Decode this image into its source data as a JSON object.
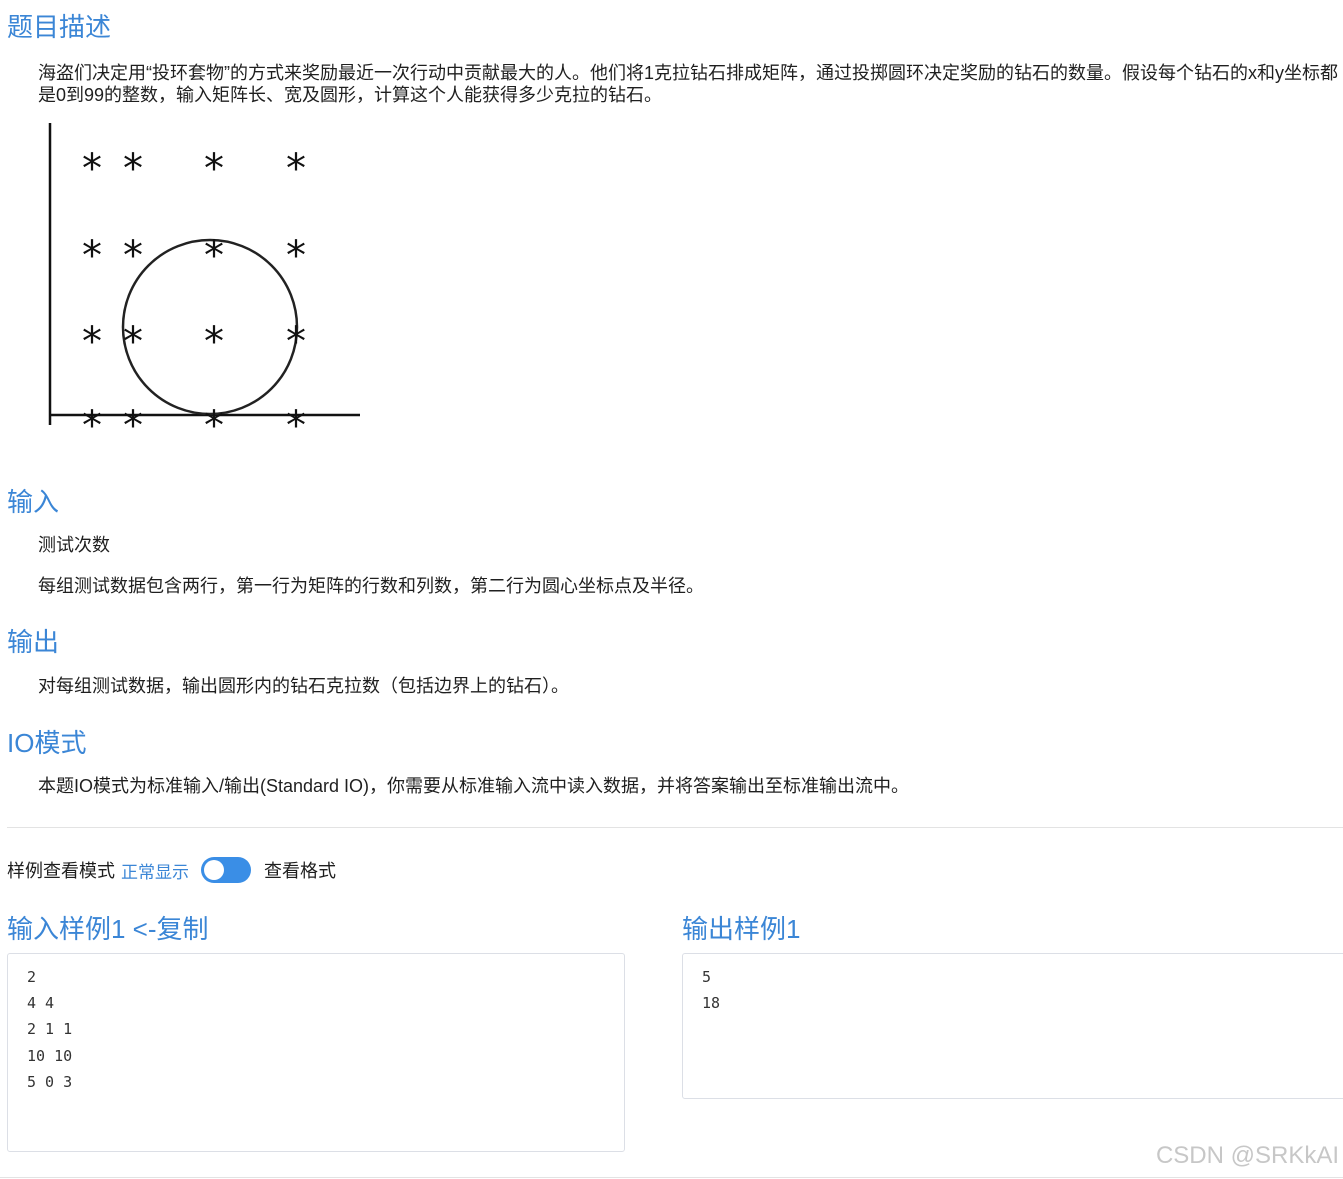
{
  "description": {
    "title": "题目描述",
    "text": "海盗们决定用“投环套物”的方式来奖励最近一次行动中贡献最大的人。他们将1克拉钻石排成矩阵，通过投掷圆环决定奖励的钻石的数量。假设每个钻石的x和y坐标都是0到99的整数，输入矩阵长、宽及圆形，计算这个人能获得多少克拉的钻石。",
    "figure_glyph": "*"
  },
  "input": {
    "title": "输入",
    "lines": [
      "测试次数",
      "每组测试数据包含两行，第一行为矩阵的行数和列数，第二行为圆心坐标点及半径。"
    ]
  },
  "output": {
    "title": "输出",
    "text": "对每组测试数据，输出圆形内的钻石克拉数（包括边界上的钻石）。"
  },
  "io_mode": {
    "title": "IO模式",
    "text": "本题IO模式为标准输入/输出(Standard IO)，你需要从标准输入流中读入数据，并将答案输出至标准输出流中。"
  },
  "sample_mode": {
    "label": "样例查看模式",
    "normal": "正常显示",
    "format": "查看格式",
    "toggle_on": false
  },
  "samples": {
    "input_title": "输入样例1 <-复制",
    "input_lines": [
      "2",
      "4 4",
      "2 1 1",
      "10 10",
      "5 0 3"
    ],
    "output_title": "输出样例1",
    "output_lines": [
      "5",
      "18"
    ]
  },
  "watermark": "CSDN @SRKkAI",
  "colors": {
    "accent": "#3b86d6",
    "toggle": "#3a8ee6"
  }
}
